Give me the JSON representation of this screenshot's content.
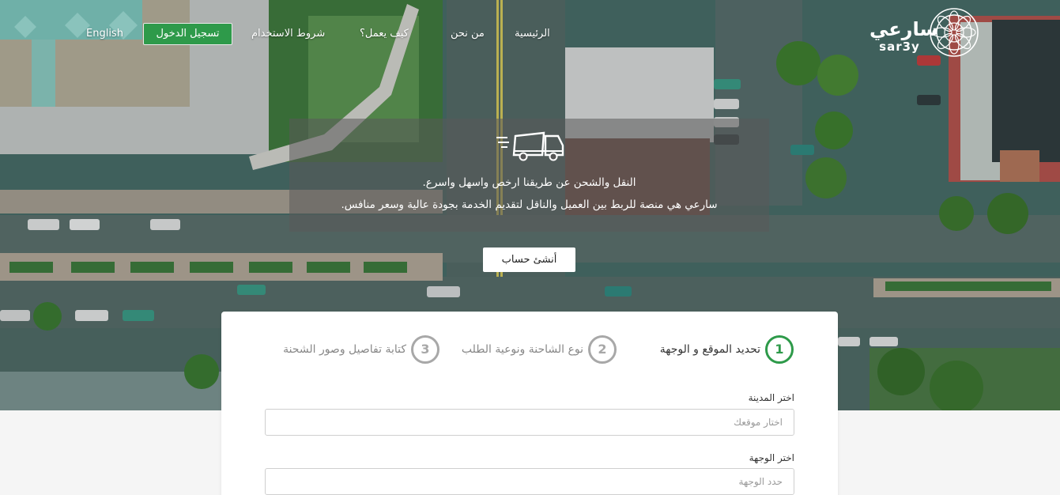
{
  "nav": {
    "brand_ar": "سارعي",
    "brand_en": "sar3y",
    "home": "الرئيسية",
    "about": "من نحن",
    "how_it_works": "كيف يعمل؟",
    "terms": "شروط الاستخدام",
    "login": "تسجيل الدخول",
    "language": "English"
  },
  "hero": {
    "tagline_1": "النقل والشحن عن طريقنا ارخص واسهل واسرع.",
    "tagline_2": "سارعي هي منصة للربط بين العميل والناقل لتقديم الخدمة بجودة عالية وسعر منافس.",
    "create_account": "أنشئ حساب"
  },
  "steps": [
    {
      "number": "1",
      "label": "تحديد الموقع و الوجهة",
      "active": true
    },
    {
      "number": "2",
      "label": "نوع الشاحنة ونوعية الطلب",
      "active": false
    },
    {
      "number": "3",
      "label": "كتابة تفاصيل وصور الشحنة",
      "active": false
    }
  ],
  "form": {
    "city_label": "اختر المدينة",
    "city_placeholder": "اختار موقعك",
    "destination_label": "اختر الوجهة",
    "destination_placeholder": "حدد الوجهة"
  },
  "colors": {
    "accent_green": "#2e9a4a",
    "inactive_gray": "#a8a8a8"
  }
}
